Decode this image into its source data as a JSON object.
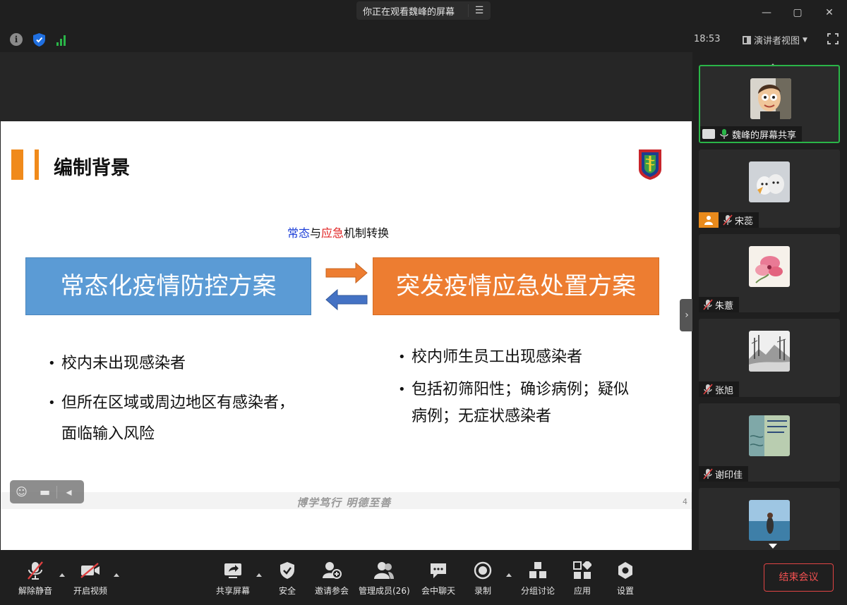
{
  "titlebar": {
    "viewing_text": "你正在观看魏峰的屏幕"
  },
  "infobar": {
    "time": "18:53",
    "speaker_view_label": "演讲者视图"
  },
  "slide": {
    "title": "编制背景",
    "subtitle_part1": "常态",
    "subtitle_part2": "与",
    "subtitle_part3": "应急",
    "subtitle_part4": "机制转换",
    "left_box": "常态化疫情防控方案",
    "right_box": "突发疫情应急处置方案",
    "left_bullets": [
      "校内未出现感染者",
      "但所在区域或周边地区有感染者，面临输入风险"
    ],
    "right_bullets": [
      "校内师生员工出现感染者",
      "包括初筛阳性；确诊病例；疑似病例；无症状感染者"
    ],
    "motto": "博学笃行  明德至善",
    "page_number": "4",
    "colors": {
      "accent": "#f08a1b",
      "blue_box": "#5b9bd5",
      "orange_box": "#ed7d31"
    }
  },
  "gallery": {
    "participants": [
      {
        "name": "魏峰的屏幕共享",
        "active": true
      },
      {
        "name": "宋蕊"
      },
      {
        "name": "朱薏"
      },
      {
        "name": "张旭"
      },
      {
        "name": "谢印佳"
      }
    ]
  },
  "toolbar": {
    "unmute": "解除静音",
    "start_video": "开启视频",
    "share_screen": "共享屏幕",
    "security": "安全",
    "invite": "邀请参会",
    "manage_members": "管理成员(26)",
    "chat": "会中聊天",
    "record": "录制",
    "breakout": "分组讨论",
    "apps": "应用",
    "settings": "设置",
    "end_meeting": "结束会议"
  }
}
